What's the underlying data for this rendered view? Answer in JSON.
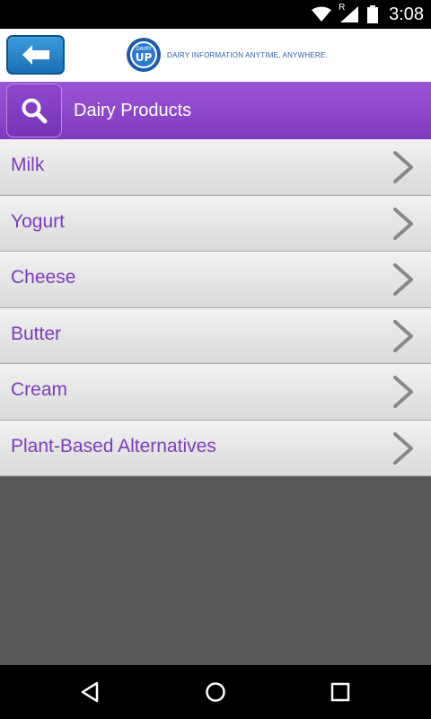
{
  "status_bar": {
    "time": "3:08",
    "network_indicator": "R"
  },
  "header": {
    "logo_text": "DAIRY UP",
    "tagline": "DAIRY INFORMATION ANYTIME, ANYWHERE."
  },
  "title_bar": {
    "title": "Dairy Products"
  },
  "list": {
    "items": [
      {
        "label": "Milk"
      },
      {
        "label": "Yogurt"
      },
      {
        "label": "Cheese"
      },
      {
        "label": "Butter"
      },
      {
        "label": "Cream"
      },
      {
        "label": "Plant-Based Alternatives"
      }
    ]
  },
  "colors": {
    "accent_purple": "#8b46cc",
    "label_purple": "#7c3cbb",
    "back_button_blue": "#2a86cb",
    "background_gray": "#575757"
  },
  "icons": [
    "back-arrow-icon",
    "search-icon",
    "chevron-right-icon",
    "wifi-icon",
    "signal-icon",
    "battery-icon",
    "nav-back-icon",
    "nav-home-icon",
    "nav-recents-icon"
  ]
}
